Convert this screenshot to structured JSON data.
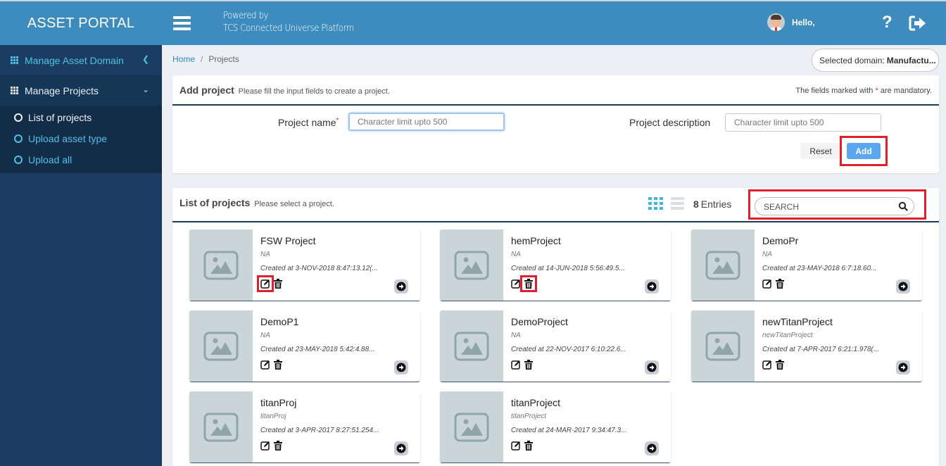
{
  "header": {
    "brand": "ASSET PORTAL",
    "powered_line1": "Powered by",
    "powered_line2": "TCS Connected Universe Platform",
    "greeting": "Hello,",
    "help_icon": "question-icon",
    "logout_icon": "sign-out-icon"
  },
  "sidebar": {
    "items": [
      {
        "label": "Manage Asset Domain",
        "icon": "grid-icon",
        "chevron": "chevron-left-icon"
      },
      {
        "label": "Manage Projects",
        "icon": "grid-icon",
        "chevron": "chevron-down-icon"
      }
    ],
    "submenu": [
      {
        "label": "List of projects",
        "active": true
      },
      {
        "label": "Upload asset type",
        "active": false
      },
      {
        "label": "Upload all",
        "active": false
      }
    ]
  },
  "breadcrumb": {
    "home": "Home",
    "separator": "/",
    "current": "Projects"
  },
  "domain": {
    "label": "Selected domain:",
    "value": "Manufactu..."
  },
  "add_project": {
    "title": "Add project",
    "subtitle": "Please fill the input fields to create a project.",
    "mandatory_prefix": "The fields marked with",
    "mandatory_star": "*",
    "mandatory_suffix": "are mandatory.",
    "name_label": "Project name",
    "name_star": "*",
    "name_placeholder": "Character limit upto 500",
    "name_value": "",
    "desc_label": "Project description",
    "desc_placeholder": "Character limit upto 500",
    "desc_value": "",
    "reset_label": "Reset",
    "add_label": "Add"
  },
  "project_list": {
    "title": "List of projects",
    "subtitle": "Please select a project.",
    "entries_count": "8",
    "entries_label": "Entries",
    "search_placeholder": "SEARCH",
    "search_value": "",
    "view_mode": "grid",
    "projects": [
      {
        "name": "FSW Project",
        "description": "NA",
        "created": "Created at 3-NOV-2018 8:47:13.12(..."
      },
      {
        "name": "hemProject",
        "description": "NA",
        "created": "Created at 14-JUN-2018 5:56:49.5..."
      },
      {
        "name": "DemoPr",
        "description": "NA",
        "created": "Created at 23-MAY-2018 6:7:18.60..."
      },
      {
        "name": "DemoP1",
        "description": "NA",
        "created": "Created at 23-MAY-2018 5:42:4.88..."
      },
      {
        "name": "DemoProject",
        "description": "NA",
        "created": "Created at 22-NOV-2017 6:10:22.6..."
      },
      {
        "name": "newTitanProject",
        "description": "newTitanProject",
        "created": "Created at 7-APR-2017 6:21:1.978(..."
      },
      {
        "name": "titanProj",
        "description": "titanProj",
        "created": "Created at 3-APR-2017 8:27:51.254..."
      },
      {
        "name": "titanProject",
        "description": "titanProject",
        "created": "Created at 24-MAR-2017 9:34:47.3..."
      }
    ]
  },
  "colors": {
    "header_bg": "#3d8cbd",
    "sidebar_bg": "#1b3d61",
    "accent_link": "#4fc1e9",
    "add_button": "#5aa7f0",
    "highlight": "#e0202a"
  }
}
